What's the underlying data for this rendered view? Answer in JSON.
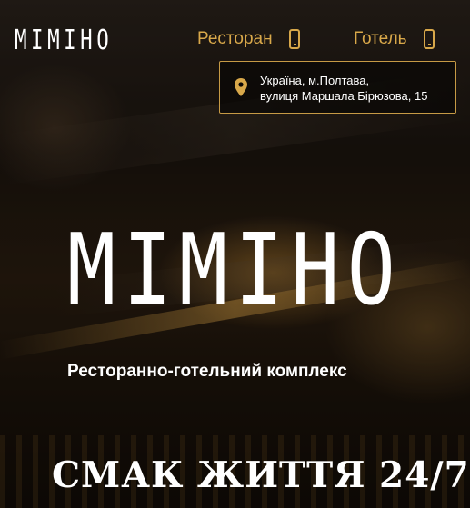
{
  "header": {
    "logo_text": "MIMIHO",
    "nav": [
      {
        "label": "Ресторан",
        "icon": "phone-icon"
      },
      {
        "label": "Готель",
        "icon": "phone-icon"
      }
    ],
    "address": {
      "icon": "map-pin-icon",
      "line1": "Україна, м.Полтава,",
      "line2": "вулиця Маршала Бірюзова, 15"
    }
  },
  "hero": {
    "logo_text": "MIMIHO",
    "subtitle": "Ресторанно-готельний комплекс",
    "slogan": "СМАК ЖИТТЯ 24/7"
  },
  "colors": {
    "accent": "#d8a84a",
    "text": "#ffffff"
  }
}
